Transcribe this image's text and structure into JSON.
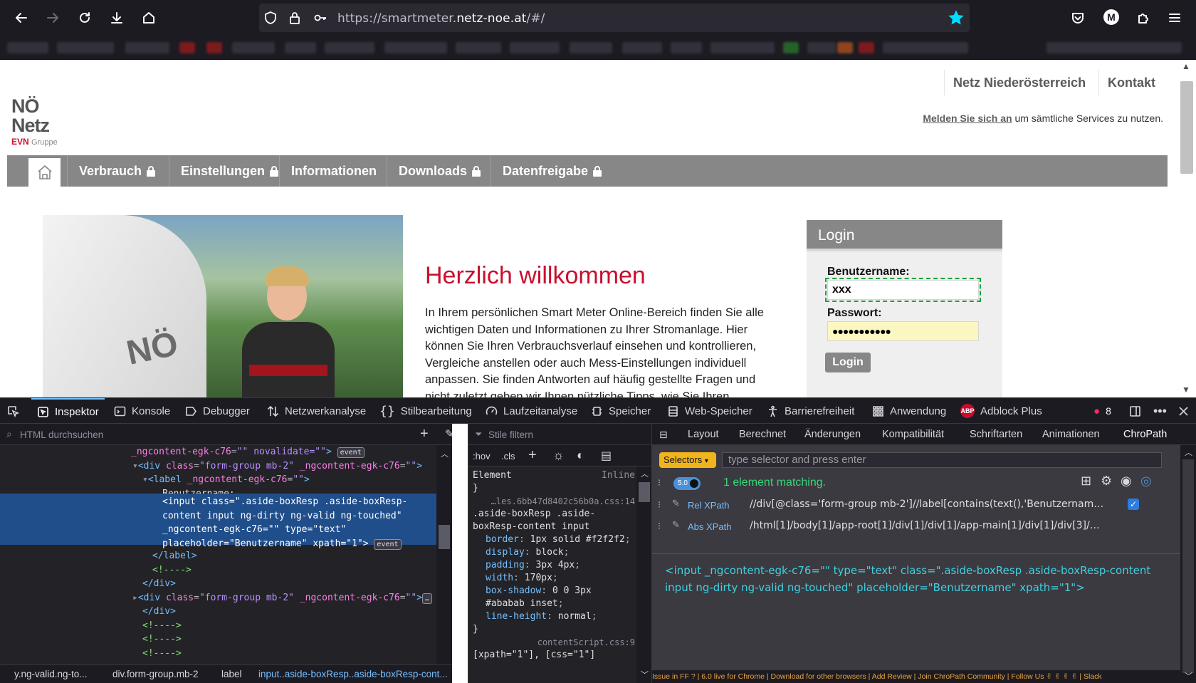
{
  "browser": {
    "url_prefix": "https://smartmeter.",
    "url_domain": "netz-noe.at",
    "url_suffix": "/#/",
    "profile_initial": "M"
  },
  "site": {
    "topnav": [
      "Netz Niederösterreich",
      "Kontakt"
    ],
    "logo": {
      "line1": "NÖ",
      "line2": "Netz",
      "brand": "EVN",
      "brand_sub": "Gruppe"
    },
    "login_prompt_link": "Melden Sie sich an",
    "login_prompt_rest": " um sämtliche Services zu nutzen.",
    "menu": [
      "Verbrauch",
      "Einstellungen",
      "Informationen",
      "Downloads",
      "Datenfreigabe"
    ],
    "hero_van_text": "NÖ",
    "welcome_title": "Herzlich willkommen",
    "welcome_text": "In Ihrem persönlichen Smart Meter Online-Bereich finden Sie alle wichtigen Daten und Informationen zu Ihrer Stromanlage. Hier können Sie Ihren Verbrauchsverlauf einsehen und kontrollieren, Vergleiche anstellen oder auch Mess-Einstellungen individuell anpassen. Sie finden Antworten auf häufig gestellte Fragen und nicht zuletzt geben wir Ihnen nützliche Tipps, wie Sie Ihren",
    "login": {
      "title": "Login",
      "user_label": "Benutzername:",
      "user_value": "xxx",
      "pass_label": "Passwort:",
      "pass_value": "●●●●●●●●●●●",
      "button": "Login"
    }
  },
  "devtools": {
    "tabs": [
      "Inspektor",
      "Konsole",
      "Debugger",
      "Netzwerkanalyse",
      "Stilbearbeitung",
      "Laufzeitanalyse",
      "Speicher",
      "Web-Speicher",
      "Barrierefreiheit",
      "Anwendung",
      "Adblock Plus"
    ],
    "error_count": "8",
    "html_search_placeholder": "HTML durchsuchen",
    "styles_filter_placeholder": "Stile filtern",
    "breadcrumb": [
      "y.ng-valid.ng-to...",
      "div.form-group.mb-2",
      "label",
      "input..aside-boxResp..aside-boxResp-cont..."
    ],
    "rules": {
      "hov": ":hov",
      "cls": ".cls",
      "element_selector": "Element",
      "element_source": "Inline",
      "rule_source": "…les.6bb47d8402c56b0a.css:14",
      "rule_selector": ".aside-boxResp .aside-boxResp-content input",
      "props": [
        {
          "name": "border",
          "value": "1px solid #f2f2f2"
        },
        {
          "name": "display",
          "value": "block"
        },
        {
          "name": "padding",
          "value": "3px 4px"
        },
        {
          "name": "width",
          "value": "170px"
        },
        {
          "name": "box-shadow",
          "value": "0 0 3px #ababab inset"
        },
        {
          "name": "line-height",
          "value": "normal"
        }
      ],
      "next_source": "contentScript.css:9",
      "next_selector": "[xpath=\"1\"], [css=\"1\"]"
    },
    "chro": {
      "tabs": [
        "Layout",
        "Berechnet",
        "Änderungen",
        "Kompatibilität",
        "Schriftarten",
        "Animationen",
        "ChroPath"
      ],
      "selectors_label": "Selectors",
      "input_placeholder": "type selector and press enter",
      "version": "5.0",
      "match_text": "1 element matching.",
      "rel_label": "Rel XPath",
      "rel_value": "//div[@class='form-group mb-2']//label[contains(text(),'Benutzernam…",
      "abs_label": "Abs XPath",
      "abs_value": "/html[1]/body[1]/app-root[1]/div[1]/div[1]/app-main[1]/div[1]/div[3]/…",
      "result": "<input _ngcontent-egk-c76=\"\" type=\"text\" class=\".aside-boxResp .aside-boxResp-content input ng-dirty ng-valid ng-touched\" placeholder=\"Benutzername\" xpath=\"1\">",
      "footer": "Issue in FF ? | 6.0 live for Chrome | Download for other browsers | Add Review | Join ChroPath Community | Follow Us ✌ ✌ ✌ ✌ | Slack"
    }
  },
  "colors": {
    "brand_red": "#c8102e",
    "nav_gray": "#878787",
    "devtools_bg": "#232327",
    "selection": "#204e8a"
  }
}
